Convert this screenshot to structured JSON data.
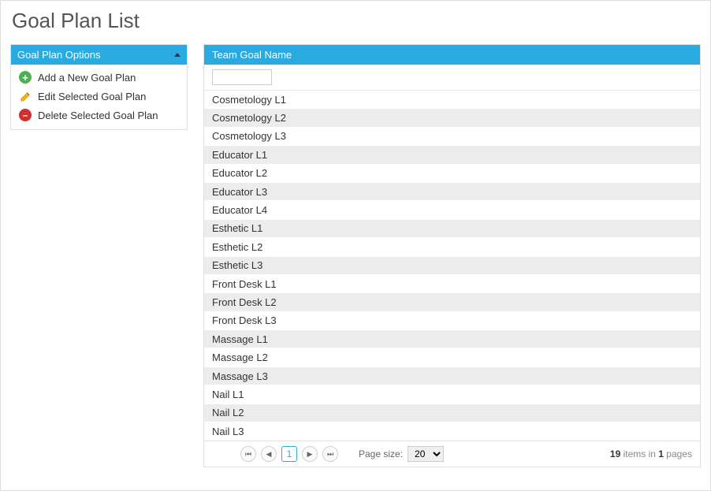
{
  "title": "Goal Plan List",
  "sidebar": {
    "header": "Goal Plan Options",
    "options": [
      {
        "label": "Add a New Goal Plan",
        "icon": "add"
      },
      {
        "label": "Edit Selected Goal Plan",
        "icon": "edit"
      },
      {
        "label": "Delete Selected Goal Plan",
        "icon": "delete"
      }
    ]
  },
  "grid": {
    "column_header": "Team Goal Name",
    "filter_value": "",
    "rows": [
      "Cosmetology L1",
      "Cosmetology L2",
      "Cosmetology L3",
      "Educator L1",
      "Educator L2",
      "Educator L3",
      "Educator L4",
      "Esthetic L1",
      "Esthetic L2",
      "Esthetic L3",
      "Front Desk L1",
      "Front Desk L2",
      "Front Desk L3",
      "Massage L1",
      "Massage L2",
      "Massage L3",
      "Nail L1",
      "Nail L2",
      "Nail L3"
    ],
    "pager": {
      "current_page": "1",
      "page_size_label": "Page size:",
      "page_size": "20",
      "total_items": "19",
      "items_text": " items in ",
      "total_pages": "1",
      "pages_text": " pages"
    }
  }
}
